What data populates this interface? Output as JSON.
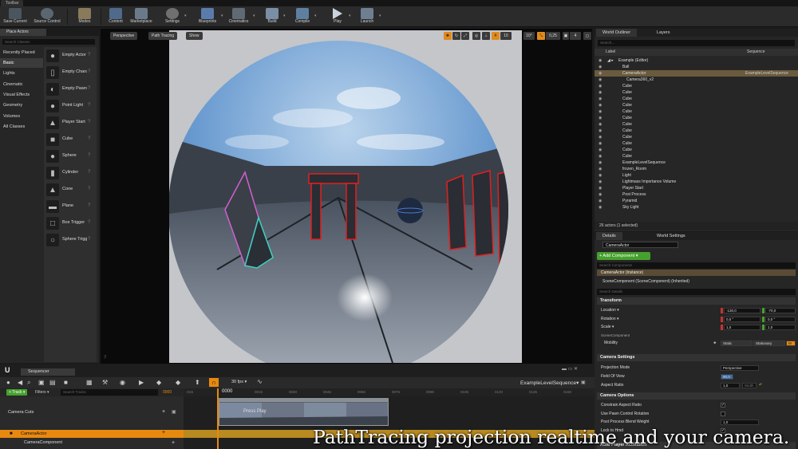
{
  "toolbar": {
    "tab": "Toolbar",
    "buttons": [
      {
        "label": "Save Current",
        "icon": "save-icon"
      },
      {
        "label": "Source Control",
        "icon": "source-control-icon"
      },
      {
        "label": "Modes",
        "icon": "modes-icon"
      },
      {
        "label": "Content",
        "icon": "content-icon"
      },
      {
        "label": "Marketplace",
        "icon": "marketplace-icon"
      },
      {
        "label": "Settings",
        "icon": "settings-icon"
      },
      {
        "label": "Blueprints",
        "icon": "blueprints-icon"
      },
      {
        "label": "Cinematics",
        "icon": "cinematics-icon"
      },
      {
        "label": "Build",
        "icon": "build-icon"
      },
      {
        "label": "Compile",
        "icon": "compile-icon"
      },
      {
        "label": "Play",
        "icon": "play-icon"
      },
      {
        "label": "Launch",
        "icon": "launch-icon"
      }
    ]
  },
  "place_actors": {
    "tab": "Place Actors",
    "search_placeholder": "Search Classes",
    "categories": [
      "Recently Placed",
      "Basic",
      "Lights",
      "Cinematic",
      "Visual Effects",
      "Geometry",
      "Volumes",
      "All Classes"
    ],
    "active_category": "Basic",
    "actors": [
      "Empty Actor",
      "Empty Character",
      "Empty Pawn",
      "Point Light",
      "Player Start",
      "Cube",
      "Sphere",
      "Cylinder",
      "Cone",
      "Plane",
      "Box Trigger",
      "Sphere Trigger"
    ]
  },
  "viewport": {
    "perspective": "Perspective",
    "view_mode": "Path Tracing",
    "show": "Show",
    "grid_snap": "10",
    "rotation_snap": "10°",
    "scale_snap": "0,25",
    "camera_speed": "4"
  },
  "outliner": {
    "tabs": [
      "World Outliner",
      "Layers"
    ],
    "search_placeholder": "Search...",
    "col_label": "Label",
    "col_sequence": "Sequence",
    "rows": [
      {
        "label": "Example (Editor)",
        "sequence": ""
      },
      {
        "label": "Ball",
        "sequence": ""
      },
      {
        "label": "CameraActor",
        "sequence": "ExampleLevelSequence",
        "selected": true
      },
      {
        "label": "Camera360_v2",
        "sequence": ""
      },
      {
        "label": "Cube",
        "sequence": ""
      },
      {
        "label": "Cube",
        "sequence": ""
      },
      {
        "label": "Cube",
        "sequence": ""
      },
      {
        "label": "Cube",
        "sequence": ""
      },
      {
        "label": "Cube",
        "sequence": ""
      },
      {
        "label": "Cube",
        "sequence": ""
      },
      {
        "label": "Cube",
        "sequence": ""
      },
      {
        "label": "Cube",
        "sequence": ""
      },
      {
        "label": "Cube",
        "sequence": ""
      },
      {
        "label": "Cube",
        "sequence": ""
      },
      {
        "label": "Cube",
        "sequence": ""
      },
      {
        "label": "Cube",
        "sequence": ""
      },
      {
        "label": "ExampleLevelSequence",
        "sequence": ""
      },
      {
        "label": "frozen_Room",
        "sequence": ""
      },
      {
        "label": "Light",
        "sequence": ""
      },
      {
        "label": "Lightmass Importance Volume",
        "sequence": ""
      },
      {
        "label": "Player Start",
        "sequence": ""
      },
      {
        "label": "Post Process",
        "sequence": ""
      },
      {
        "label": "Pyramid",
        "sequence": ""
      },
      {
        "label": "Sky Light",
        "sequence": ""
      }
    ],
    "count": "26 actors (1 selected)"
  },
  "details": {
    "tabs": [
      "Details",
      "World Settings"
    ],
    "actor_name": "CameraActor",
    "add_component": "+ Add Component ▾",
    "search_components": "Search Components",
    "component_self": "CameraActor (Instance)",
    "component_scene": "SceneComponent (SceneComponent) (Inherited)",
    "search_details": "Search Details",
    "transform": {
      "header": "Transform",
      "location_label": "Location ▾",
      "location": {
        "x": "-130,0",
        "y": "-70,0"
      },
      "rotation_label": "Rotation ▾",
      "rotation": {
        "x": "0,0 °",
        "y": "0,0 °"
      },
      "scale_label": "Scale ▾",
      "scale": {
        "x": "1,0",
        "y": "1,0"
      },
      "scene_component": "SceneComponent",
      "mobility_label": "Mobility",
      "mobility_static": "Static",
      "mobility_stationary": "Stationary",
      "mobility_movable": "M"
    },
    "camera_settings": {
      "header": "Camera Settings",
      "projection_label": "Projection Mode",
      "projection": "Perspective",
      "fov_label": "Field Of View",
      "fov": "90,0",
      "aspect_label": "Aspect Ratio",
      "aspect": "1,0",
      "width_label": "Width"
    },
    "camera_options": {
      "header": "Camera Options",
      "constrain": "Constrain Aspect Ratio",
      "pawn_control": "Use Pawn Control Rotation",
      "blend_label": "Post Process Blend Weight",
      "blend": "1,0",
      "lock_hmd": "Lock to Hmd",
      "auto_player": "Auto Player Activation"
    }
  },
  "sequencer": {
    "tab": "Sequencer",
    "track_button": "+ Track ▾",
    "filters": "Filters ▾",
    "search_placeholder": "Search Tracks",
    "start_frame": "0000",
    "framerate": "30 fps ▾",
    "sequence_name": "ExampleLevelSequence▾",
    "timecode": "0000",
    "ticks": [
      "-015",
      "0015",
      "0030",
      "0045",
      "0060",
      "0075",
      "0090",
      "0105",
      "0120",
      "0135",
      "0150"
    ],
    "tracks": [
      "Camera Cuts",
      "CameraActor",
      "CameraComponent"
    ],
    "clip_label": "Press Play"
  },
  "caption": "PathTracing projection realtime and your camera.",
  "colors": {
    "accent": "#e8890f",
    "add_green": "#46a02e",
    "selected": "#6b5a3e"
  }
}
